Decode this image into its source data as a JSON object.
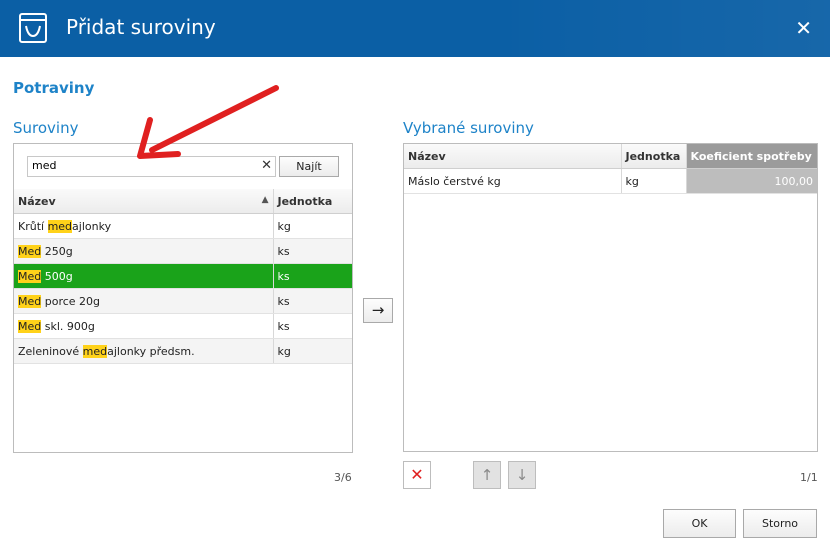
{
  "window": {
    "title": "Přidat suroviny",
    "close_symbol": "✕"
  },
  "section_title": "Potraviny",
  "left_panel": {
    "title": "Suroviny",
    "search_value": "med",
    "clear_symbol": "✕",
    "find_button": "Najít",
    "columns": [
      "Název",
      "Jednotka"
    ],
    "sort_indicator": "▲",
    "rows": [
      {
        "pre": "Krůtí ",
        "hl": "med",
        "post": "ajlonky",
        "unit": "kg",
        "selected": false
      },
      {
        "pre": "",
        "hl": "Med",
        "post": " 250g",
        "unit": "ks",
        "selected": false
      },
      {
        "pre": "",
        "hl": "Med",
        "post": " 500g",
        "unit": "ks",
        "selected": true
      },
      {
        "pre": "",
        "hl": "Med",
        "post": " porce 20g",
        "unit": "ks",
        "selected": false
      },
      {
        "pre": "",
        "hl": "Med",
        "post": " skl. 900g",
        "unit": "ks",
        "selected": false
      },
      {
        "pre": "Zeleninové ",
        "hl": "med",
        "post": "ajlonky  předsm.",
        "unit": "kg",
        "selected": false
      }
    ],
    "count": "3/6"
  },
  "move_button_symbol": "→",
  "right_panel": {
    "title": "Vybrané suroviny",
    "columns": [
      "Název",
      "Jednotka",
      "Koeficient spotřeby"
    ],
    "rows": [
      {
        "name": "Máslo čerstvé kg",
        "unit": "kg",
        "coef": "100,00"
      }
    ],
    "count": "1/1",
    "delete_symbol": "✕",
    "up_symbol": "↑",
    "down_symbol": "↓"
  },
  "footer": {
    "ok": "OK",
    "cancel": "Storno"
  },
  "colors": {
    "titlebar": "#0b5fa5",
    "accent": "#1e83c8",
    "selected_row": "#1aa31a",
    "highlight": "#ffd21a",
    "annotation_arrow": "#e02020"
  }
}
